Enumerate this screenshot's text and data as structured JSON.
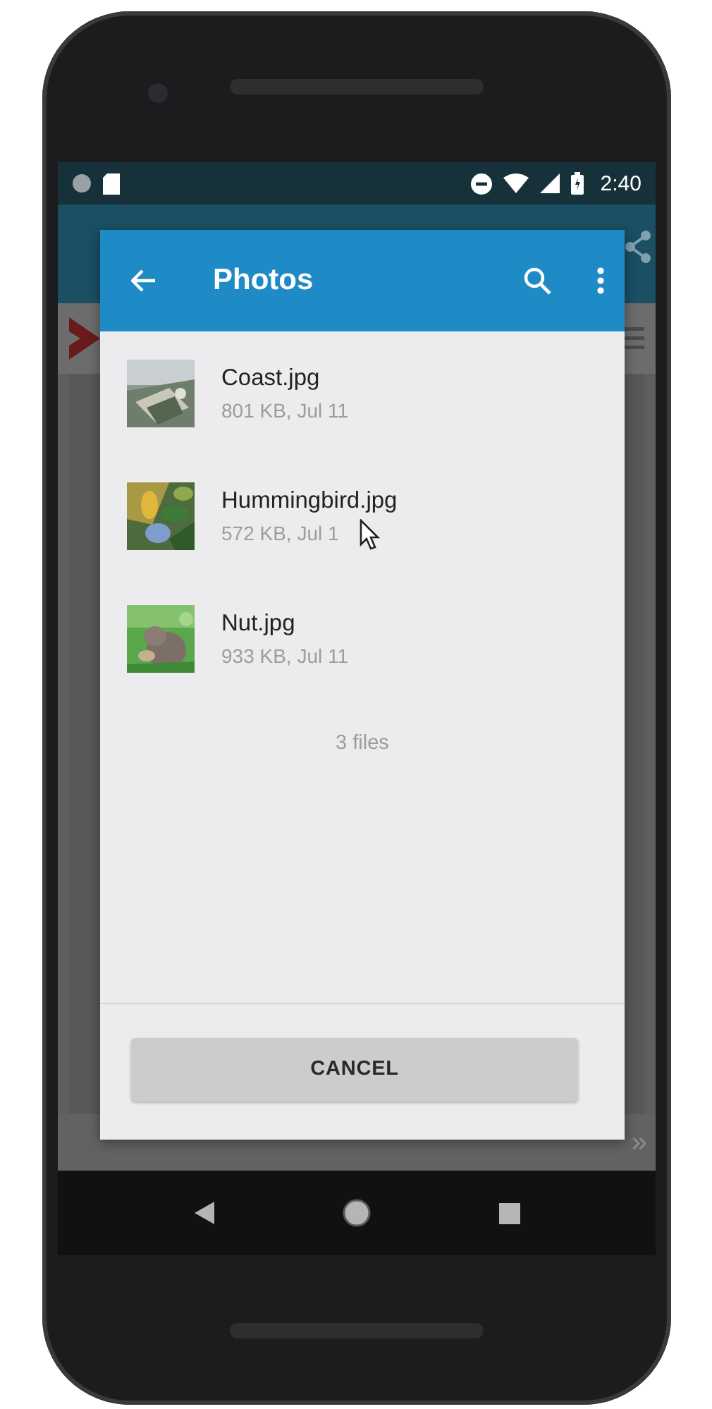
{
  "status_bar": {
    "time": "2:40"
  },
  "background": {
    "pager_glyph": "»"
  },
  "dialog": {
    "title": "Photos",
    "files": [
      {
        "name": "Coast.jpg",
        "details": "801 KB, Jul 11"
      },
      {
        "name": "Hummingbird.jpg",
        "details": "572 KB, Jul 1"
      },
      {
        "name": "Nut.jpg",
        "details": "933 KB, Jul 11"
      }
    ],
    "summary": "3 files",
    "button": "CANCEL"
  }
}
